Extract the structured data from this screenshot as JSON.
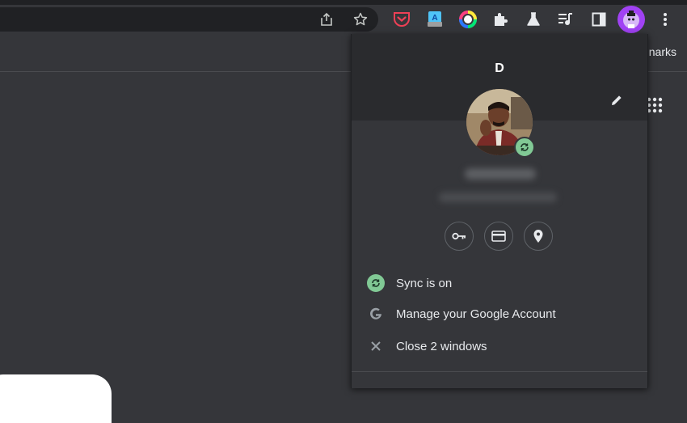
{
  "bookmarks_bar": {
    "text": "narks"
  },
  "profile_popup": {
    "title": "D",
    "menu": [
      {
        "label": "Sync is on",
        "icon": "sync-icon"
      },
      {
        "label": "Manage your Google Account",
        "icon": "google-icon"
      },
      {
        "label": "Close 2 windows",
        "icon": "close-icon"
      }
    ],
    "quick_actions": [
      "password-key-icon",
      "payment-card-icon",
      "location-pin-icon"
    ]
  },
  "toolbar": {
    "icons": [
      "share-icon",
      "bookmark-star-icon",
      "pocket-icon",
      "translate-extension-icon",
      "color-picker-extension-icon",
      "extensions-puzzle-icon",
      "labs-flask-icon",
      "media-queue-icon",
      "side-panel-icon",
      "profile-avatar-icon",
      "more-menu-icon"
    ]
  },
  "colors": {
    "background": "#35363a",
    "omnibox": "#202124",
    "sync_green": "#81c995",
    "pocket_red": "#ef4056",
    "avatar_purple": "#a142f4"
  }
}
